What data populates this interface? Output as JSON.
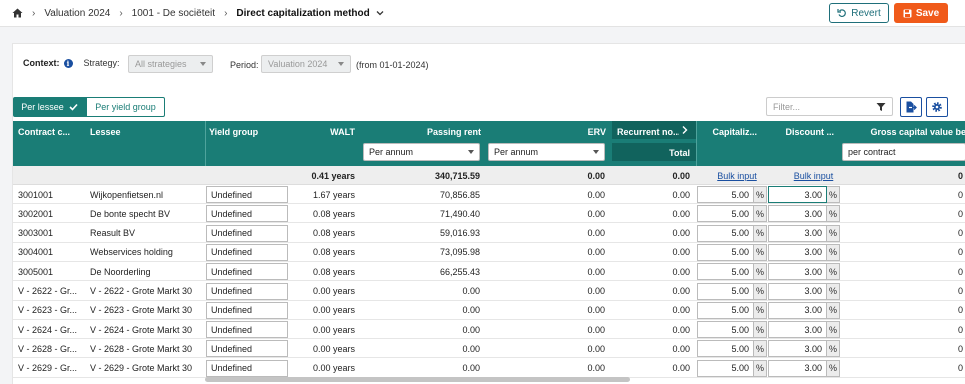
{
  "breadcrumb": {
    "home_icon": "home-icon",
    "items": [
      "Valuation 2024",
      "1001 - De sociëteit",
      "Direct capitalization method"
    ]
  },
  "toolbar": {
    "revert_label": "Revert",
    "save_label": "Save"
  },
  "context": {
    "label": "Context:",
    "strategy_label": "Strategy:",
    "strategy_value": "All strategies",
    "period_label": "Period:",
    "period_value": "Valuation 2024",
    "period_note": "(from 01-01-2024)"
  },
  "tabs": {
    "per_lessee": "Per lessee",
    "per_yield_group": "Per yield group"
  },
  "filter": {
    "placeholder": "Filter..."
  },
  "columns": {
    "contract": "Contract c...",
    "lessee": "Lessee",
    "yield_group": "Yield group",
    "walt": "WALT",
    "passing_rent": "Passing rent",
    "passing_rent_select": "Per annum",
    "erv": "ERV",
    "erv_select": "Per annum",
    "recurrent": "Recurrent no...",
    "recurrent_sub": "Total",
    "capitalization": "Capitaliz...",
    "discount": "Discount ...",
    "gross_capital_value": "Gross capital value be",
    "gross_select": "per contract"
  },
  "totals": {
    "walt": "0.41 years",
    "passing_rent": "340,715.59",
    "erv": "0.00",
    "recurrent": "0.00",
    "cap_link": "Bulk input",
    "disc_link": "Bulk input",
    "gross": "0"
  },
  "rows": [
    {
      "contract": "3001001",
      "lessee": "Wijkopenfietsen.nl",
      "yield_group": "Undefined",
      "walt": "1.67 years",
      "passing_rent": "70,856.85",
      "erv": "0.00",
      "recurrent": "0.00",
      "cap": "5.00",
      "disc": "3.00",
      "gross": "0"
    },
    {
      "contract": "3002001",
      "lessee": "De bonte specht BV",
      "yield_group": "Undefined",
      "walt": "0.08 years",
      "passing_rent": "71,490.40",
      "erv": "0.00",
      "recurrent": "0.00",
      "cap": "5.00",
      "disc": "3.00",
      "gross": "0"
    },
    {
      "contract": "3003001",
      "lessee": "Reasult BV",
      "yield_group": "Undefined",
      "walt": "0.08 years",
      "passing_rent": "59,016.93",
      "erv": "0.00",
      "recurrent": "0.00",
      "cap": "5.00",
      "disc": "3.00",
      "gross": "0"
    },
    {
      "contract": "3004001",
      "lessee": "Webservices holding",
      "yield_group": "Undefined",
      "walt": "0.08 years",
      "passing_rent": "73,095.98",
      "erv": "0.00",
      "recurrent": "0.00",
      "cap": "5.00",
      "disc": "3.00",
      "gross": "0"
    },
    {
      "contract": "3005001",
      "lessee": "De Noorderling",
      "yield_group": "Undefined",
      "walt": "0.08 years",
      "passing_rent": "66,255.43",
      "erv": "0.00",
      "recurrent": "0.00",
      "cap": "5.00",
      "disc": "3.00",
      "gross": "0"
    },
    {
      "contract": "V - 2622 - Gr...",
      "lessee": "V - 2622 - Grote Markt 30",
      "yield_group": "Undefined",
      "walt": "0.00 years",
      "passing_rent": "0.00",
      "erv": "0.00",
      "recurrent": "0.00",
      "cap": "5.00",
      "disc": "3.00",
      "gross": "0"
    },
    {
      "contract": "V - 2623 - Gr...",
      "lessee": "V - 2623 - Grote Markt 30",
      "yield_group": "Undefined",
      "walt": "0.00 years",
      "passing_rent": "0.00",
      "erv": "0.00",
      "recurrent": "0.00",
      "cap": "5.00",
      "disc": "3.00",
      "gross": "0"
    },
    {
      "contract": "V - 2624 - Gr...",
      "lessee": "V - 2624 - Grote Markt 30",
      "yield_group": "Undefined",
      "walt": "0.00 years",
      "passing_rent": "0.00",
      "erv": "0.00",
      "recurrent": "0.00",
      "cap": "5.00",
      "disc": "3.00",
      "gross": "0"
    },
    {
      "contract": "V - 2628 - Gr...",
      "lessee": "V - 2628 - Grote Markt 30",
      "yield_group": "Undefined",
      "walt": "0.00 years",
      "passing_rent": "0.00",
      "erv": "0.00",
      "recurrent": "0.00",
      "cap": "5.00",
      "disc": "3.00",
      "gross": "0"
    },
    {
      "contract": "V - 2629 - Gr...",
      "lessee": "V - 2629 - Grote Markt 30",
      "yield_group": "Undefined",
      "walt": "0.00 years",
      "passing_rent": "0.00",
      "erv": "0.00",
      "recurrent": "0.00",
      "cap": "5.00",
      "disc": "3.00",
      "gross": "0"
    }
  ],
  "percent_symbol": "%"
}
